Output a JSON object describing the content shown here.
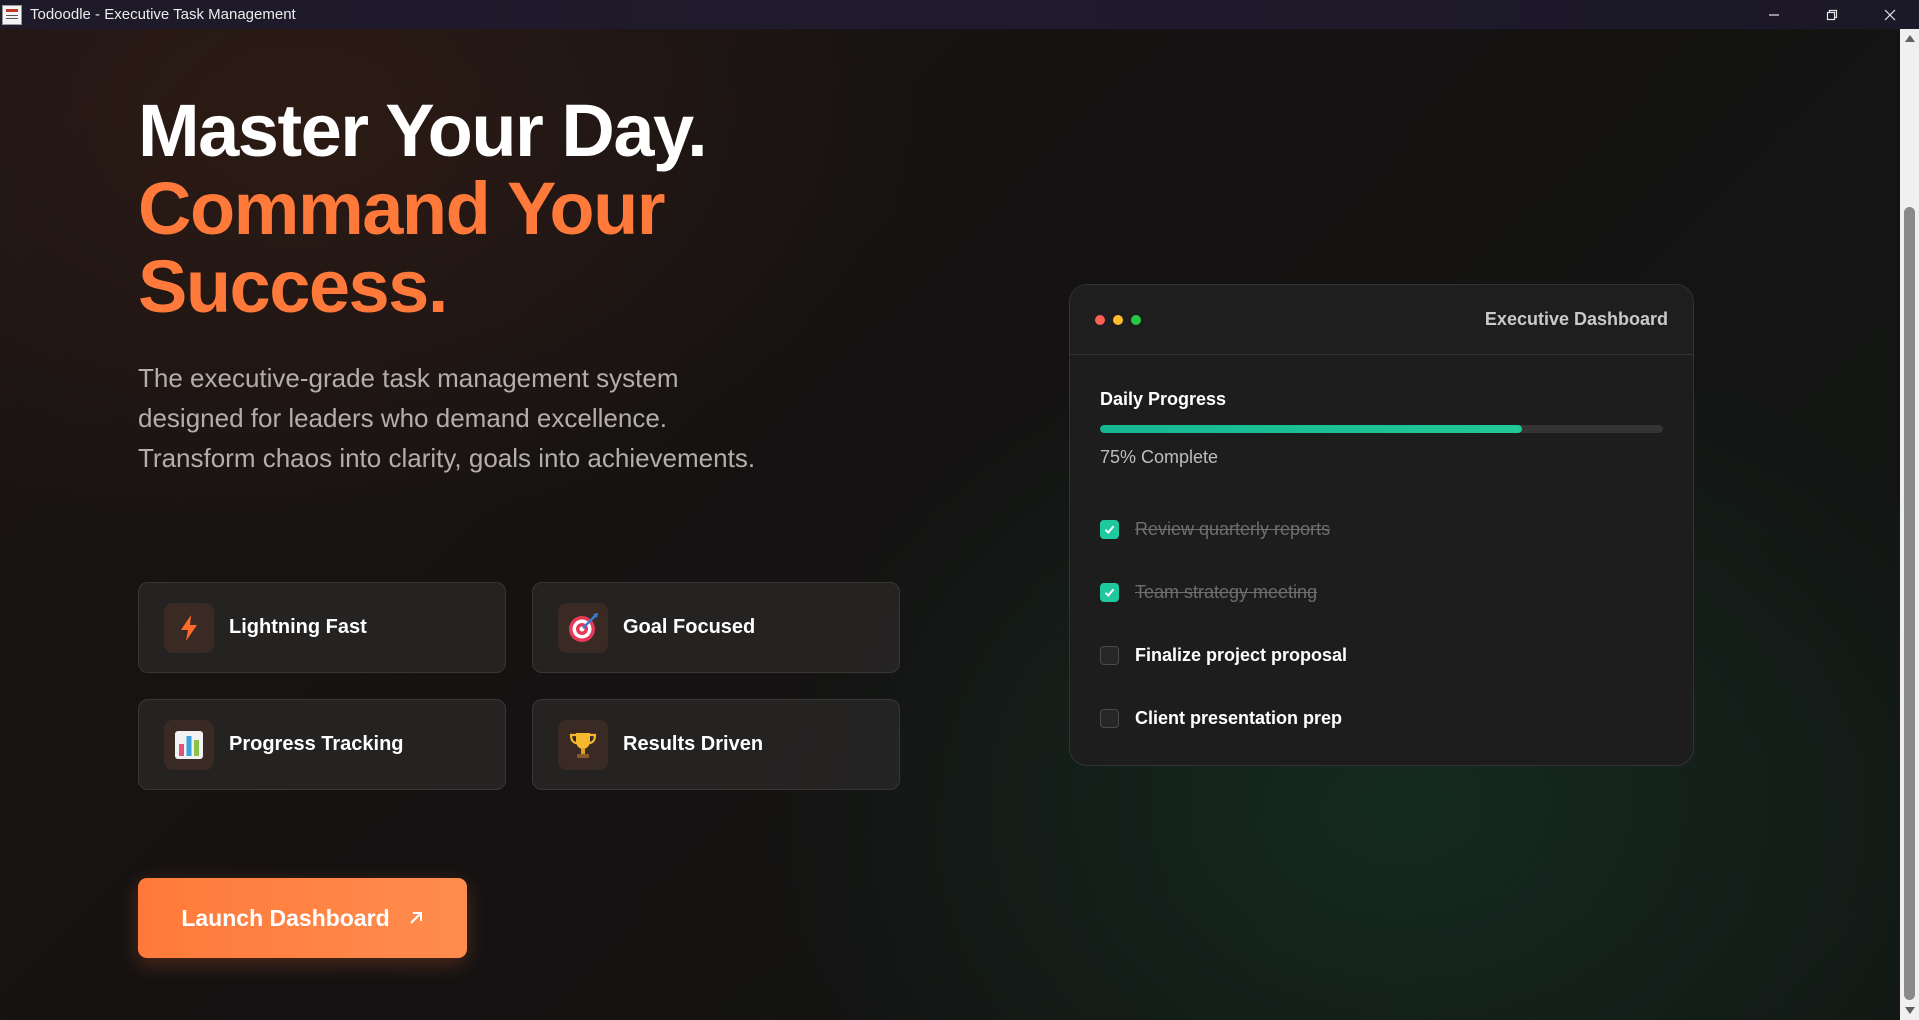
{
  "window": {
    "title": "Todoodle - Executive Task Management"
  },
  "hero": {
    "line1": "Master Your Day.",
    "line2": "Command Your Success.",
    "description": "The executive-grade task management system designed for leaders who demand excellence. Transform chaos into clarity, goals into achievements."
  },
  "features": [
    {
      "label": "Lightning Fast",
      "icon": "lightning-icon"
    },
    {
      "label": "Goal Focused",
      "icon": "target-icon"
    },
    {
      "label": "Progress Tracking",
      "icon": "bar-chart-icon"
    },
    {
      "label": "Results Driven",
      "icon": "trophy-icon"
    }
  ],
  "cta": {
    "label": "Launch Dashboard",
    "icon": "arrow-up-right-icon"
  },
  "dashboard": {
    "title": "Executive Dashboard",
    "progress_label": "Daily Progress",
    "progress_value": 0.75,
    "progress_text": "75% Complete",
    "tasks": [
      {
        "label": "Review quarterly reports",
        "done": true
      },
      {
        "label": "Team strategy meeting",
        "done": true
      },
      {
        "label": "Finalize project proposal",
        "done": false
      },
      {
        "label": "Client presentation prep",
        "done": false
      }
    ]
  },
  "colors": {
    "accent": "#ff7a3a",
    "progress": "#20c997",
    "dot_red": "#ff5f57",
    "dot_yellow": "#febc2e",
    "dot_green": "#28c840"
  }
}
